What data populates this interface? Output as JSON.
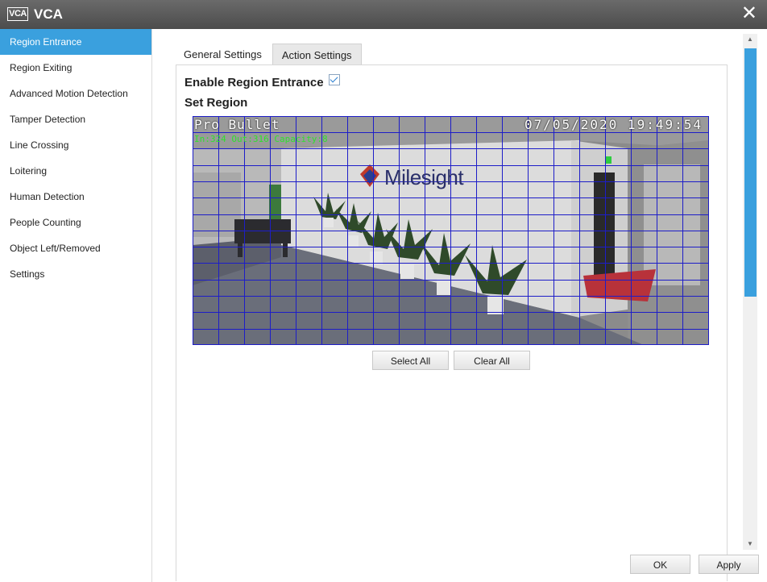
{
  "window": {
    "logo_text": "VCA",
    "title": "VCA",
    "close_glyph": "✕"
  },
  "sidebar": {
    "items": [
      {
        "label": "Region Entrance",
        "active": true
      },
      {
        "label": "Region Exiting"
      },
      {
        "label": "Advanced Motion Detection"
      },
      {
        "label": "Tamper Detection"
      },
      {
        "label": "Line Crossing"
      },
      {
        "label": "Loitering"
      },
      {
        "label": "Human Detection"
      },
      {
        "label": "People Counting"
      },
      {
        "label": "Object Left/Removed"
      },
      {
        "label": "Settings"
      }
    ]
  },
  "tabs": [
    {
      "label": "General Settings",
      "active": true
    },
    {
      "label": "Action Settings",
      "active": false
    }
  ],
  "form": {
    "enable_label": "Enable Region Entrance",
    "enable_checked": true,
    "set_region_label": "Set Region"
  },
  "video": {
    "osd_camera": "Pro Bullet",
    "osd_datetime": "07/05/2020 19:49:54",
    "osd_counts": "In:324 Out:316 Capacity:8",
    "wall_brand": "Milesight",
    "grid_color": "#1d1dc8"
  },
  "buttons": {
    "select_all": "Select All",
    "clear_all": "Clear All",
    "ok": "OK",
    "apply": "Apply"
  },
  "colors": {
    "accent": "#3aa0de",
    "titlebar": "#555555"
  },
  "icons": {
    "close": "close-icon",
    "check": "check-icon",
    "scroll_up": "scroll-up-icon",
    "scroll_down": "scroll-down-icon"
  }
}
